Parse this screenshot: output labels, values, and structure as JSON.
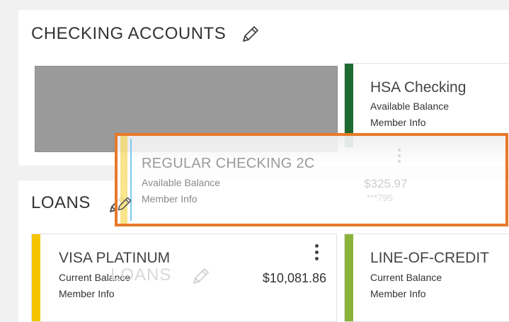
{
  "checking": {
    "title": "CHECKING ACCOUNTS",
    "edit_icon": "pencil-icon",
    "accounts": [
      {
        "name": "HSA Checking",
        "label1": "Available Balance",
        "label2": "Member Info",
        "color": "#1e6b30"
      }
    ]
  },
  "dragged": {
    "name": "REGULAR CHECKING 2C",
    "label1": "Available Balance",
    "label2": "Member Info",
    "amount": "$325.97",
    "acct": "***795",
    "highlight_color": "#e8792a"
  },
  "loans": {
    "title": "LOANS",
    "ghost_title": "LOANS",
    "edit_icon": "pencil-icon",
    "accounts": [
      {
        "name": "VISA PLATINUM",
        "label1": "Current Balance",
        "label2": "Member Info",
        "amount": "$10,081.86",
        "color": "#f5c400"
      },
      {
        "name": "LINE-OF-CREDIT",
        "label1": "Current Balance",
        "label2": "Member Info",
        "color": "#8ab23a"
      }
    ]
  }
}
